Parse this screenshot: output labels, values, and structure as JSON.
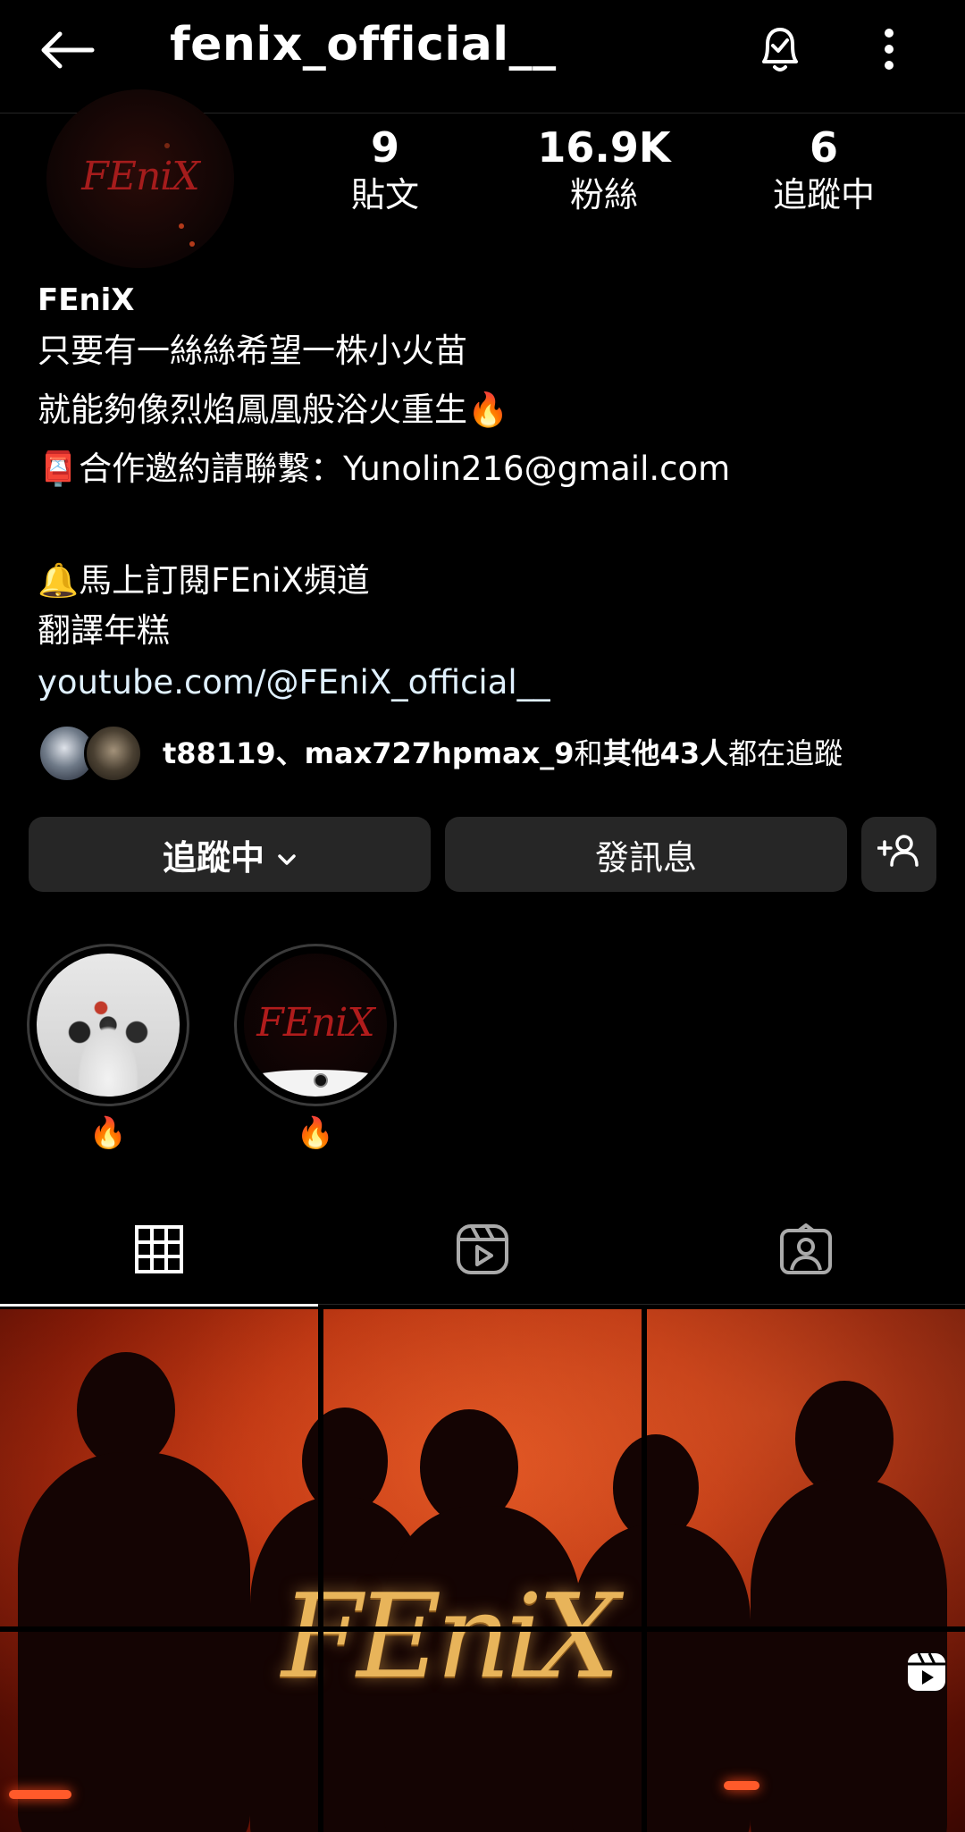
{
  "header": {
    "username": "fenix_official__"
  },
  "profile": {
    "avatar_text": "FEniX",
    "stats": [
      {
        "value": "9",
        "label": "貼文"
      },
      {
        "value": "16.9K",
        "label": "粉絲"
      },
      {
        "value": "6",
        "label": "追蹤中"
      }
    ],
    "display_name": "FEniX",
    "bio_lines": [
      "只要有一絲絲希望一株小火苗",
      "就能夠像烈焰鳳凰般浴火重生🔥",
      "📮合作邀約請聯繫：Yunolin216@gmail.com",
      "🔔馬上訂閱FEniX頻道",
      "翻譯年糕"
    ],
    "link": "youtube.com/@FEniX_official__",
    "followed_by": {
      "names": "t88119、max727hpmax_9",
      "middle": "和",
      "others": "其他43人",
      "suffix": "都在追蹤"
    }
  },
  "actions": {
    "following_label": "追蹤中",
    "message_label": "發訊息"
  },
  "highlights": [
    {
      "label": "🔥"
    },
    {
      "label": "🔥",
      "cover_text": "FEniX"
    }
  ],
  "tabs": [
    "posts-grid",
    "reels",
    "tagged"
  ],
  "post": {
    "overlay_text": "FEniX"
  }
}
